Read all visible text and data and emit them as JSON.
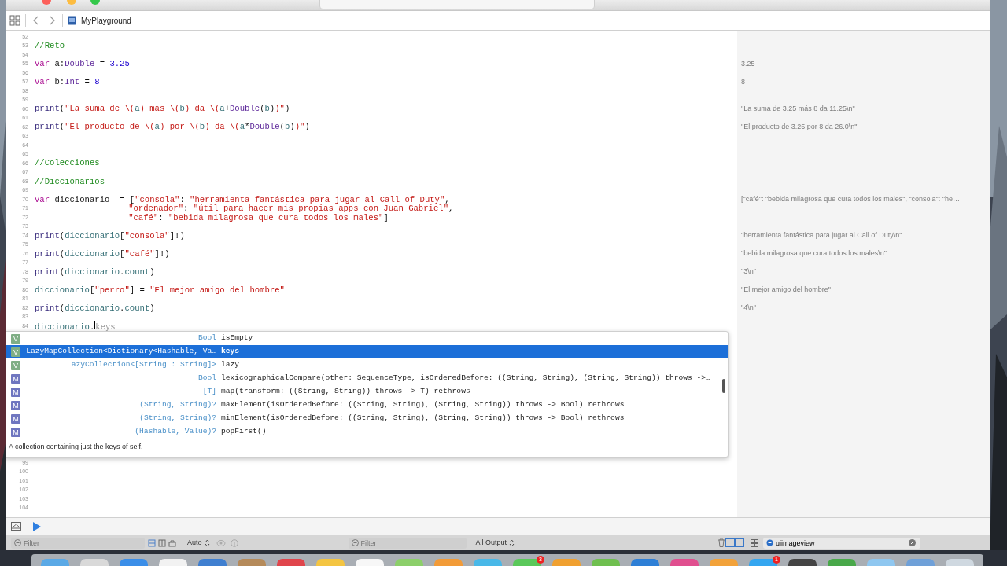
{
  "window": {
    "title": "MyPlayground"
  },
  "editor": {
    "lines": [
      {
        "number": "52"
      },
      {
        "number": "53",
        "tokens": [
          {
            "kind": "comment",
            "text": "//Reto"
          }
        ]
      },
      {
        "number": "54"
      },
      {
        "number": "55",
        "tokens": [
          {
            "kind": "keyword",
            "text": "var"
          },
          {
            "kind": "plain",
            "text": " a:"
          },
          {
            "kind": "type",
            "text": "Double"
          },
          {
            "kind": "plain",
            "text": " = "
          },
          {
            "kind": "number",
            "text": "3.25"
          }
        ],
        "result": "3.25"
      },
      {
        "number": "56"
      },
      {
        "number": "57",
        "tokens": [
          {
            "kind": "keyword",
            "text": "var"
          },
          {
            "kind": "plain",
            "text": " b:"
          },
          {
            "kind": "type",
            "text": "Int"
          },
          {
            "kind": "plain",
            "text": " = "
          },
          {
            "kind": "number",
            "text": "8"
          }
        ],
        "result": "8"
      },
      {
        "number": "58"
      },
      {
        "number": "59"
      },
      {
        "number": "60",
        "tokens": [
          {
            "kind": "func",
            "text": "print"
          },
          {
            "kind": "plain",
            "text": "("
          },
          {
            "kind": "string",
            "text": "\"La suma de \\("
          },
          {
            "kind": "ident",
            "text": "a"
          },
          {
            "kind": "string",
            "text": ") más \\("
          },
          {
            "kind": "ident",
            "text": "b"
          },
          {
            "kind": "string",
            "text": ") da \\("
          },
          {
            "kind": "ident",
            "text": "a"
          },
          {
            "kind": "plain",
            "text": "+"
          },
          {
            "kind": "type",
            "text": "Double"
          },
          {
            "kind": "plain",
            "text": "("
          },
          {
            "kind": "ident",
            "text": "b"
          },
          {
            "kind": "plain",
            "text": ")"
          },
          {
            "kind": "string",
            "text": ")\""
          },
          {
            "kind": "plain",
            "text": ")"
          }
        ],
        "result": "\"La suma de 3.25 más 8 da 11.25\\n\""
      },
      {
        "number": "61"
      },
      {
        "number": "62",
        "tokens": [
          {
            "kind": "func",
            "text": "print"
          },
          {
            "kind": "plain",
            "text": "("
          },
          {
            "kind": "string",
            "text": "\"El producto de \\("
          },
          {
            "kind": "ident",
            "text": "a"
          },
          {
            "kind": "string",
            "text": ") por \\("
          },
          {
            "kind": "ident",
            "text": "b"
          },
          {
            "kind": "string",
            "text": ") da \\("
          },
          {
            "kind": "ident",
            "text": "a"
          },
          {
            "kind": "plain",
            "text": "*"
          },
          {
            "kind": "type",
            "text": "Double"
          },
          {
            "kind": "plain",
            "text": "("
          },
          {
            "kind": "ident",
            "text": "b"
          },
          {
            "kind": "plain",
            "text": ")"
          },
          {
            "kind": "string",
            "text": ")\""
          },
          {
            "kind": "plain",
            "text": ")"
          }
        ],
        "result": "\"El producto de 3.25 por 8 da 26.0\\n\""
      },
      {
        "number": "63"
      },
      {
        "number": "64"
      },
      {
        "number": "65"
      },
      {
        "number": "66",
        "tokens": [
          {
            "kind": "comment",
            "text": "//Colecciones"
          }
        ]
      },
      {
        "number": "67"
      },
      {
        "number": "68",
        "tokens": [
          {
            "kind": "comment",
            "text": "//Diccionarios"
          }
        ]
      },
      {
        "number": "69"
      },
      {
        "number": "70",
        "tokens": [
          {
            "kind": "keyword",
            "text": "var"
          },
          {
            "kind": "plain",
            "text": " diccionario  = ["
          },
          {
            "kind": "string",
            "text": "\"consola\""
          },
          {
            "kind": "plain",
            "text": ": "
          },
          {
            "kind": "string",
            "text": "\"herramienta fantástica para jugar al Call of Duty\""
          },
          {
            "kind": "plain",
            "text": ","
          }
        ],
        "result": "[\"café\": \"bebida milagrosa que cura todos los males\", \"consola\": \"he…"
      },
      {
        "number": "71",
        "continuation": true,
        "tokens": [
          {
            "kind": "string",
            "text": "\"ordenador\""
          },
          {
            "kind": "plain",
            "text": ": "
          },
          {
            "kind": "string",
            "text": "\"útil para hacer mis propias apps con Juan Gabriel\""
          },
          {
            "kind": "plain",
            "text": ","
          }
        ]
      },
      {
        "number": "72",
        "continuation": true,
        "tokens": [
          {
            "kind": "string",
            "text": "\"café\""
          },
          {
            "kind": "plain",
            "text": ": "
          },
          {
            "kind": "string",
            "text": "\"bebida milagrosa que cura todos los males\""
          },
          {
            "kind": "plain",
            "text": "]"
          }
        ]
      },
      {
        "number": "73"
      },
      {
        "number": "74",
        "tokens": [
          {
            "kind": "func",
            "text": "print"
          },
          {
            "kind": "plain",
            "text": "("
          },
          {
            "kind": "ident",
            "text": "diccionario"
          },
          {
            "kind": "plain",
            "text": "["
          },
          {
            "kind": "string",
            "text": "\"consola\""
          },
          {
            "kind": "plain",
            "text": "]!)"
          }
        ],
        "result": "\"herramienta fantástica para jugar al Call of Duty\\n\""
      },
      {
        "number": "75"
      },
      {
        "number": "76",
        "tokens": [
          {
            "kind": "func",
            "text": "print"
          },
          {
            "kind": "plain",
            "text": "("
          },
          {
            "kind": "ident",
            "text": "diccionario"
          },
          {
            "kind": "plain",
            "text": "["
          },
          {
            "kind": "string",
            "text": "\"café\""
          },
          {
            "kind": "plain",
            "text": "]!)"
          }
        ],
        "result": "\"bebida milagrosa que cura todos los males\\n\""
      },
      {
        "number": "77"
      },
      {
        "number": "78",
        "tokens": [
          {
            "kind": "func",
            "text": "print"
          },
          {
            "kind": "plain",
            "text": "("
          },
          {
            "kind": "ident",
            "text": "diccionario"
          },
          {
            "kind": "plain",
            "text": "."
          },
          {
            "kind": "ident",
            "text": "count"
          },
          {
            "kind": "plain",
            "text": ")"
          }
        ],
        "result": "\"3\\n\""
      },
      {
        "number": "79"
      },
      {
        "number": "80",
        "tokens": [
          {
            "kind": "ident",
            "text": "diccionario"
          },
          {
            "kind": "plain",
            "text": "["
          },
          {
            "kind": "string",
            "text": "\"perro\""
          },
          {
            "kind": "plain",
            "text": "] = "
          },
          {
            "kind": "string",
            "text": "\"El mejor amigo del hombre\""
          }
        ],
        "result": "\"El mejor amigo del hombre\""
      },
      {
        "number": "81"
      },
      {
        "number": "82",
        "tokens": [
          {
            "kind": "func",
            "text": "print"
          },
          {
            "kind": "plain",
            "text": "("
          },
          {
            "kind": "ident",
            "text": "diccionario"
          },
          {
            "kind": "plain",
            "text": "."
          },
          {
            "kind": "ident",
            "text": "count"
          },
          {
            "kind": "plain",
            "text": ")"
          }
        ],
        "result": "\"4\\n\""
      },
      {
        "number": "83"
      },
      {
        "number": "84",
        "tokens": [
          {
            "kind": "ident",
            "text": "diccionario"
          },
          {
            "kind": "plain",
            "text": "."
          },
          {
            "kind": "cursor"
          },
          {
            "kind": "ghost",
            "text": "keys"
          }
        ]
      }
    ],
    "lines_below": [
      {
        "number": "99"
      },
      {
        "number": "100"
      },
      {
        "number": "101"
      },
      {
        "number": "102"
      },
      {
        "number": "103"
      },
      {
        "number": "104"
      }
    ]
  },
  "completion": {
    "items": [
      {
        "kind": "property",
        "badge": "V",
        "type": "Bool",
        "name": "isEmpty",
        "selected": false
      },
      {
        "kind": "property",
        "badge": "V",
        "type": "LazyMapCollection<Dictionary<Hashable, Va…",
        "name": "keys",
        "selected": true
      },
      {
        "kind": "property",
        "badge": "V",
        "type": "LazyCollection<[String : String]>",
        "name": "lazy",
        "selected": false
      },
      {
        "kind": "method",
        "badge": "M",
        "type": "Bool",
        "name": "lexicographicalCompare(other: SequenceType, isOrderedBefore: ((String, String), (String, String)) throws ->…",
        "selected": false
      },
      {
        "kind": "method",
        "badge": "M",
        "type": "[T]",
        "name": "map(transform: ((String, String)) throws -> T) rethrows",
        "selected": false
      },
      {
        "kind": "method",
        "badge": "M",
        "type": "(String, String)?",
        "name": "maxElement(isOrderedBefore: ((String, String), (String, String)) throws -> Bool) rethrows",
        "selected": false
      },
      {
        "kind": "method",
        "badge": "M",
        "type": "(String, String)?",
        "name": "minElement(isOrderedBefore: ((String, String), (String, String)) throws -> Bool) rethrows",
        "selected": false
      },
      {
        "kind": "method",
        "badge": "M",
        "type": "(Hashable, Value)?",
        "name": "popFirst()",
        "selected": false
      }
    ],
    "description": "A collection containing just the keys of self."
  },
  "debug_bar": {
    "filter_placeholder": "Filter",
    "mode": "Auto",
    "output_filter_placeholder": "Filter",
    "output_mode": "All Output",
    "library_search": "uiimageview"
  },
  "dock": {
    "items": [
      {
        "color": "#5aa9e6"
      },
      {
        "color": "#d9d9d9"
      },
      {
        "color": "#3b8ee8"
      },
      {
        "color": "#f2f2f2"
      },
      {
        "color": "#3f7fd0"
      },
      {
        "color": "#b58a5a"
      },
      {
        "color": "#e0454c"
      },
      {
        "color": "#f4c542"
      },
      {
        "color": "#f7f7f7"
      },
      {
        "color": "#8ccf6a"
      },
      {
        "color": "#f29b38"
      },
      {
        "color": "#49b8e8"
      },
      {
        "color": "#5ac85a",
        "badge": "3"
      },
      {
        "color": "#f0a030"
      },
      {
        "color": "#6fbf4f"
      },
      {
        "color": "#2e7fd6"
      },
      {
        "color": "#e04f8f"
      },
      {
        "color": "#f2a23a"
      },
      {
        "color": "#34a6f0",
        "badge": "1"
      },
      {
        "color": "#444444"
      },
      {
        "color": "#49a84a"
      },
      {
        "color": "#8fc7f0"
      },
      {
        "color": "#6fa0d8"
      },
      {
        "color": "#cfd8e0"
      }
    ]
  }
}
